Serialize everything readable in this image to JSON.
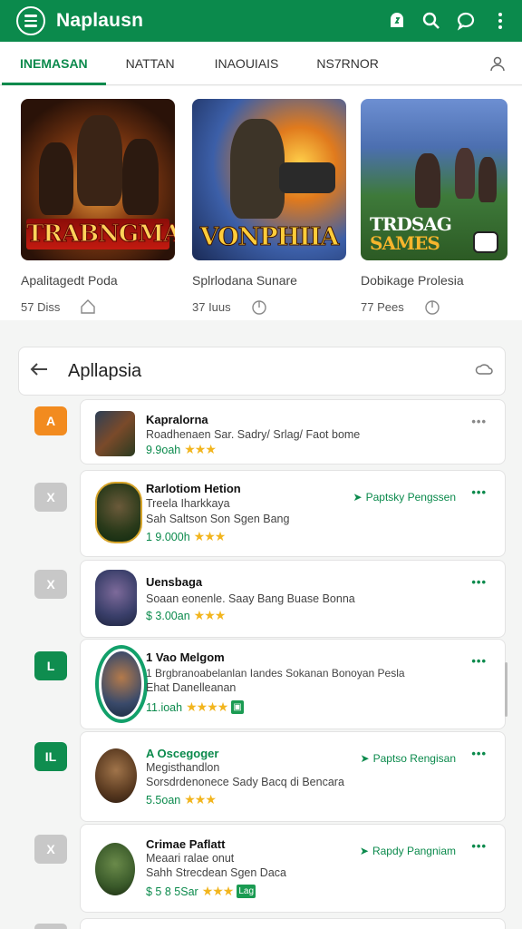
{
  "app": {
    "title": "Naplausn",
    "accent": "#0b8a4c"
  },
  "appbar_icons": [
    "menu-icon",
    "notification-icon",
    "search-icon",
    "chat-icon",
    "more-vert-icon"
  ],
  "tabs": [
    {
      "label": "INEMASAN",
      "active": true
    },
    {
      "label": "NATTAN",
      "active": false
    },
    {
      "label": "INAOUIAIS",
      "active": false
    },
    {
      "label": "NS7RNOR",
      "active": false
    }
  ],
  "featured": [
    {
      "art_text": "TRABNGMAA",
      "name": "Apalitagedt Poda",
      "meta": "57 Diss",
      "icon": "home-icon"
    },
    {
      "art_text": "VONPHIIA",
      "name": "Splrlodana Sunare",
      "meta": "37 Iuus",
      "icon": "tap-icon"
    },
    {
      "art_text_1": "TRDSAG",
      "art_text_2": "SAMES",
      "name": "Dobikage Prolesia",
      "meta": "77 Pees",
      "icon": "tap-icon"
    }
  ],
  "section": {
    "title": "Apllapsia"
  },
  "list": [
    {
      "rank": "A",
      "name": "Kapralorna",
      "sub1": "Roadhenaen Sar. Sadry/ Srlag/ Faot bome",
      "rating": "9.9oah",
      "stars": "★★★",
      "tag": "",
      "more": "•••"
    },
    {
      "rank": "X",
      "name": "Rarlotiom Hetion",
      "sub1": "Treela Iharkkaya",
      "sub2": "Sah Saltson Son Sgen Bang",
      "rating": "1 9.000h",
      "stars": "★★★",
      "tag": "Paptsky Pengssen",
      "more": "•••"
    },
    {
      "rank": "X",
      "name": "Uensbaga",
      "sub1": "Soaan eonenle. Saay Bang Buase Bonna",
      "rating": "$ 3.00an",
      "stars": "★★★",
      "tag": "",
      "more": "•••"
    },
    {
      "rank": "L",
      "name": "1 Vao Melgom",
      "sub1": "1 Brgbranoabelanlan Iandes Sokanan Bonoyan Pesla",
      "sub2": "Ehat Danelleanan",
      "rating": "11.ioah",
      "stars": "★★★★",
      "badge": "▣",
      "tag": "",
      "more": "•••"
    },
    {
      "rank": "IL",
      "name": "A Oscegoger",
      "sub1": "Megisthandlon",
      "sub2": "Sorsdrdenonece Sady Bacq di Bencara",
      "rating": "5.5oan",
      "stars": "★★★",
      "tag": "Paptso Rengisan",
      "more": "•••"
    },
    {
      "rank": "X",
      "name": "Crimae Paflatt",
      "sub1": "Meaari ralae onut",
      "sub2": "Sahh Strecdean Sgen Daca",
      "rating": "$ 5 8 5Sar",
      "stars": "★★★",
      "badge": "Lag",
      "tag": "Rapdy Pangniam",
      "more": "•••"
    }
  ]
}
